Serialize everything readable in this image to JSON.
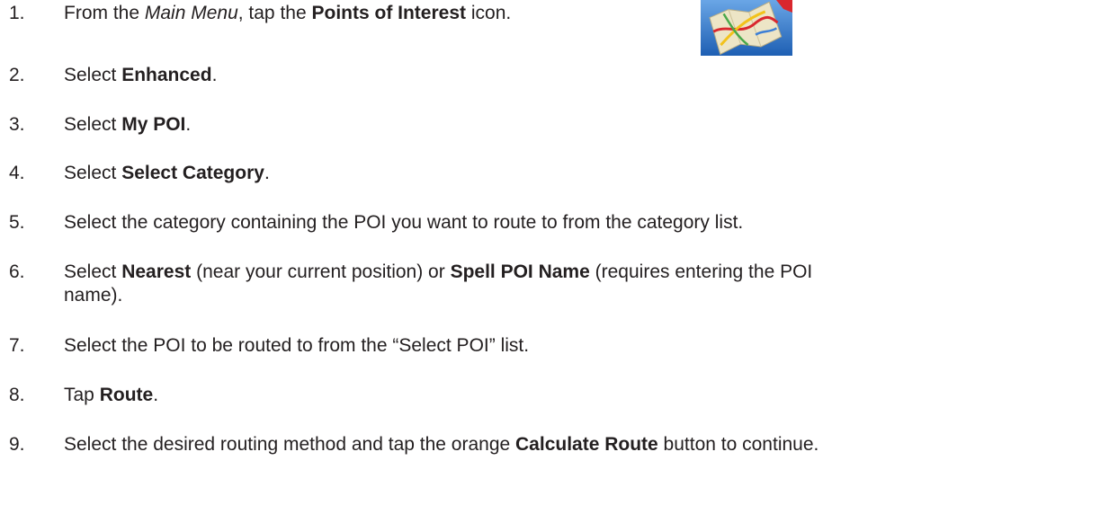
{
  "steps": [
    {
      "number": "1.",
      "parts": [
        {
          "t": "From the ",
          "s": "n"
        },
        {
          "t": "Main Menu",
          "s": "i"
        },
        {
          "t": ", tap the ",
          "s": "n"
        },
        {
          "t": "Points of Interest",
          "s": "b"
        },
        {
          "t": " icon.",
          "s": "n"
        }
      ]
    },
    {
      "number": "2.",
      "parts": [
        {
          "t": "Select ",
          "s": "n"
        },
        {
          "t": "Enhanced",
          "s": "b"
        },
        {
          "t": ".",
          "s": "n"
        }
      ]
    },
    {
      "number": "3.",
      "parts": [
        {
          "t": "Select ",
          "s": "n"
        },
        {
          "t": "My POI",
          "s": "b"
        },
        {
          "t": ".",
          "s": "n"
        }
      ]
    },
    {
      "number": "4.",
      "parts": [
        {
          "t": "Select ",
          "s": "n"
        },
        {
          "t": "Select Category",
          "s": "b"
        },
        {
          "t": ".",
          "s": "n"
        }
      ]
    },
    {
      "number": "5.",
      "parts": [
        {
          "t": "Select the category containing the POI you want to route to from the category list.",
          "s": "n"
        }
      ]
    },
    {
      "number": "6.",
      "parts": [
        {
          "t": "Select ",
          "s": "n"
        },
        {
          "t": "Nearest",
          "s": "b"
        },
        {
          "t": " (near your current position) or ",
          "s": "n"
        },
        {
          "t": "Spell POI Name",
          "s": "b"
        },
        {
          "t": " (requires entering the POI",
          "s": "n"
        }
      ],
      "continuation": "name)."
    },
    {
      "number": "7.",
      "parts": [
        {
          "t": "Select the POI to be routed to from the “Select POI” list.",
          "s": "n"
        }
      ]
    },
    {
      "number": "8.",
      "parts": [
        {
          "t": "Tap ",
          "s": "n"
        },
        {
          "t": "Route",
          "s": "b"
        },
        {
          "t": ".",
          "s": "n"
        }
      ]
    },
    {
      "number": "9.",
      "parts": [
        {
          "t": "Select the desired routing method and tap the orange ",
          "s": "n"
        },
        {
          "t": "Calculate Route",
          "s": "b"
        },
        {
          "t": " button to continue.",
          "s": "n"
        }
      ]
    }
  ],
  "icon": {
    "name": "points-of-interest-icon",
    "colors": {
      "background": "#2a72c8",
      "map": "#e9e2c2",
      "road_red": "#d9272e",
      "road_yellow": "#f2c21b",
      "road_green": "#4aa84a",
      "road_blue": "#3c7fd6"
    }
  }
}
